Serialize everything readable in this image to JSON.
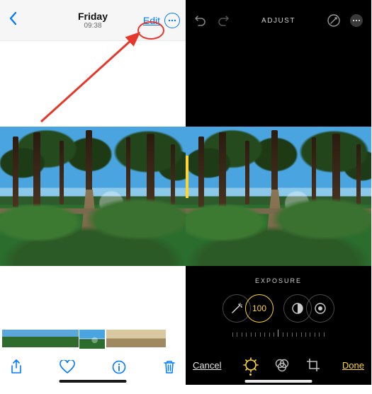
{
  "left": {
    "header": {
      "title": "Friday",
      "subtitle": "09:38",
      "edit": "Edit"
    },
    "bottom_icons": [
      "share-icon",
      "heart-icon",
      "info-icon",
      "trash-icon"
    ]
  },
  "right": {
    "header_label": "ADJUST",
    "adjustment_label": "EXPOSURE",
    "adjustment_value": "100",
    "cancel": "Cancel",
    "done": "Done"
  },
  "colors": {
    "ios_blue": "#007aff",
    "annotation_red": "#e5382b",
    "edit_yellow": "#ffd52e"
  }
}
